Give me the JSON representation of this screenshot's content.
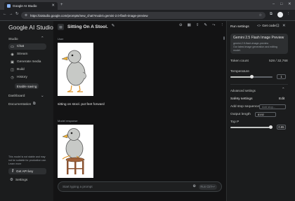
{
  "browser": {
    "tab_title": "Google AI Studio",
    "url": "https://aistudio.google.com/prompts/new_chat?model=gemini-2.0-flash-image-preview"
  },
  "sidebar": {
    "logo": "Google AI Studio",
    "studio_label": "Studio",
    "items": [
      {
        "label": "Chat",
        "icon": "chat-icon"
      },
      {
        "label": "Stream",
        "icon": "stream-icon"
      },
      {
        "label": "Generate media",
        "icon": "media-icon"
      },
      {
        "label": "Build",
        "icon": "build-icon"
      },
      {
        "label": "History",
        "icon": "history-icon"
      }
    ],
    "enable_saving": "Enable saving",
    "dashboard": "Dashboard",
    "documentation": "Documentation",
    "notice": "This model is not stable and may not be suitable for production use. Learn more",
    "get_api_key": "Get API key",
    "settings": "Settings"
  },
  "main": {
    "title": "Sitting On A Stool.",
    "user_label": "User",
    "prompt_text": "sitting on stool. put feet forward",
    "model_label": "Model response",
    "input_placeholder": "Start typing a prompt",
    "run_label": "Run  Ctrl+↵"
  },
  "panel": {
    "run_settings": "Run settings",
    "get_code": "Get code",
    "model_name": "Gemini 2.5 Flash Image Preview",
    "model_id": "gemini-2.5-flash-image-preview",
    "model_desc": "Our latest image generation and editing model.",
    "token_count_label": "Token count",
    "token_count_value": "528 / 32,768",
    "temperature_label": "Temperature",
    "temperature_value": "1",
    "temperature_fraction": 0.5,
    "advanced_settings": "Advanced settings",
    "safety_settings": "Safety settings",
    "edit": "Edit",
    "add_stop_sequence": "Add stop sequence",
    "add_stop_placeholder": "Add stop...",
    "output_length_label": "Output length",
    "output_length_value": "8192",
    "top_p_label": "Top P",
    "top_p_value": "0.95",
    "top_p_fraction": 0.95
  }
}
